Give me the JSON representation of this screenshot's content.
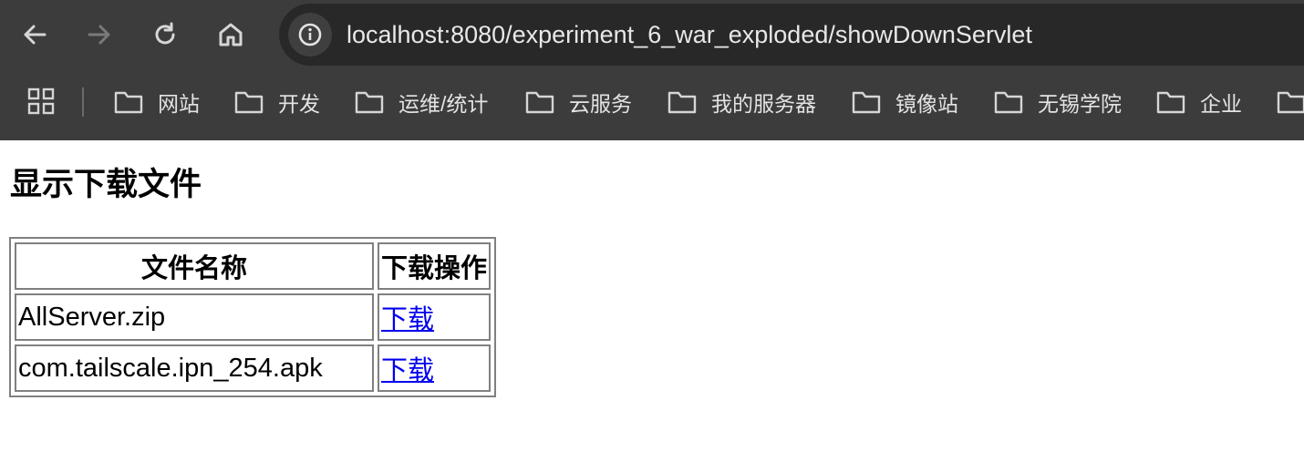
{
  "browser": {
    "nav": {
      "back_icon": "back-arrow-icon",
      "forward_icon": "forward-arrow-icon",
      "reload_icon": "reload-icon",
      "home_icon": "home-icon"
    },
    "omnibox": {
      "site_info_icon": "info-icon",
      "url": "localhost:8080/experiment_6_war_exploded/showDownServlet"
    },
    "bookmarks": [
      {
        "label": "网站"
      },
      {
        "label": "开发"
      },
      {
        "label": "运维/统计"
      },
      {
        "label": "云服务"
      },
      {
        "label": "我的服务器"
      },
      {
        "label": "镜像站"
      },
      {
        "label": "无锡学院"
      },
      {
        "label": "企业"
      }
    ],
    "colors": {
      "chrome_bg": "#3c3c3c",
      "omnibox_bg": "#282828",
      "text": "#e3e3e3"
    }
  },
  "page": {
    "title": "显示下载文件",
    "table": {
      "headers": [
        "文件名称",
        "下载操作"
      ],
      "rows": [
        {
          "file": "AllServer.zip",
          "action": "下载"
        },
        {
          "file": "com.tailscale.ipn_254.apk",
          "action": "下载"
        }
      ]
    },
    "link_color": "#0000ee"
  }
}
